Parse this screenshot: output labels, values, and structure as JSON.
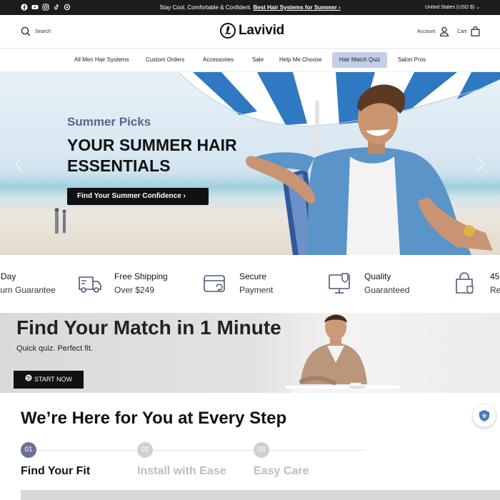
{
  "topbar": {
    "social_icons": [
      "facebook-icon",
      "youtube-icon",
      "instagram-icon",
      "tiktok-icon",
      "threads-icon"
    ],
    "announcement_text": "Stay Cool, Comfortable & Confident.",
    "announcement_link": "Best Hair Systems for Summer ›",
    "currency": "United States (USD $) ⌄"
  },
  "header": {
    "search_label": "Search",
    "logo_text": "Lavivid",
    "account_label": "Account",
    "cart_label": "Cart"
  },
  "nav": {
    "items": [
      {
        "label": "All Men Hair Systems"
      },
      {
        "label": "Custom Orders"
      },
      {
        "label": "Accessories"
      },
      {
        "label": "Sale"
      },
      {
        "label": "Help Me Choose"
      },
      {
        "label": "Hair Match Quiz",
        "active": true
      },
      {
        "label": "Salon Pros"
      }
    ]
  },
  "hero": {
    "subtitle": "Summer Picks",
    "title": "YOUR SUMMER HAIR ESSENTIALS",
    "cta": "Find Your Summer Confidence ›"
  },
  "benefits": [
    {
      "icon": "return-icon",
      "line1": "-Day",
      "line2": "turn Guarantee"
    },
    {
      "icon": "truck-icon",
      "line1": "Free Shipping",
      "line2": "Over $249"
    },
    {
      "icon": "secure-payment-icon",
      "line1": "Secure",
      "line2": "Payment"
    },
    {
      "icon": "quality-icon",
      "line1": "Quality",
      "line2": "Guaranteed"
    },
    {
      "icon": "bag-shield-icon",
      "line1": "45",
      "line2": "Re"
    }
  ],
  "quiz": {
    "title": "Find Your Match in 1 Minute",
    "subtitle": "Quick quiz. Perfect fit.",
    "button": "START NOW"
  },
  "steps": {
    "heading": "We’re Here for You at Every Step",
    "items": [
      {
        "num": "01",
        "label": "Find Your Fit",
        "active": true
      },
      {
        "num": "02",
        "label": "Install with Ease",
        "active": false
      },
      {
        "num": "03",
        "label": "Easy Care",
        "active": false
      }
    ]
  },
  "colors": {
    "accent_active_nav": "#c3cfe8",
    "hero_subtitle": "#51678f",
    "step_active": "#6b7194",
    "step_inactive": "#d0d0d0",
    "dark": "#111111"
  }
}
